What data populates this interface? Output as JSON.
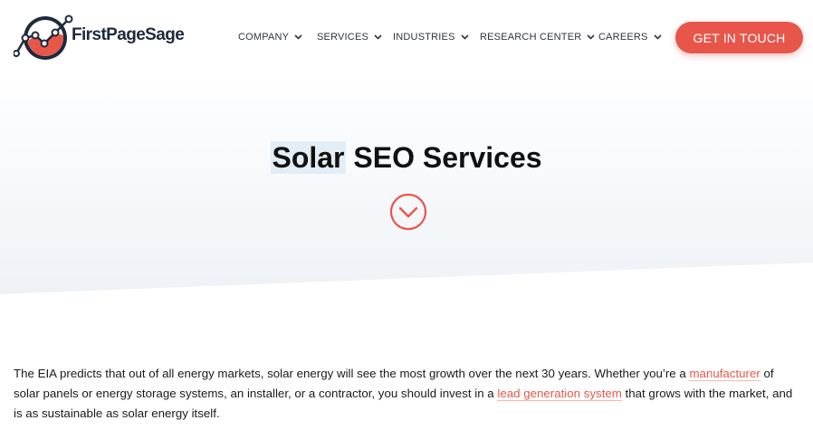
{
  "brand": {
    "name": "FirstPageSage",
    "accent": "#e8564a",
    "dark": "#1f2a3c"
  },
  "nav": {
    "items": [
      {
        "label": "COMPANY",
        "icon": "chevron-down-icon"
      },
      {
        "label": "SERVICES",
        "icon": "chevron-down-icon"
      },
      {
        "label": "INDUSTRIES",
        "icon": "chevron-down-icon"
      },
      {
        "label": "RESEARCH CENTER",
        "icon": "chevron-down-icon"
      },
      {
        "label": "CAREERS",
        "icon": "chevron-down-icon"
      }
    ],
    "cta_label": "GET IN TOUCH"
  },
  "hero": {
    "title_highlight": "Solar",
    "title_rest": " SEO Services",
    "scroll_icon": "chevron-circle-down-icon"
  },
  "intro": {
    "part1": "The EIA predicts that out of all energy markets, solar energy will see the most growth over the next 30 years. Whether you’re a ",
    "link1": "manufacturer",
    "part2": " of solar panels or energy storage systems, an installer, or a contractor, you should invest in a ",
    "link2": "lead generation system",
    "part3": " that grows with the market, and is as sustainable as solar energy itself."
  }
}
